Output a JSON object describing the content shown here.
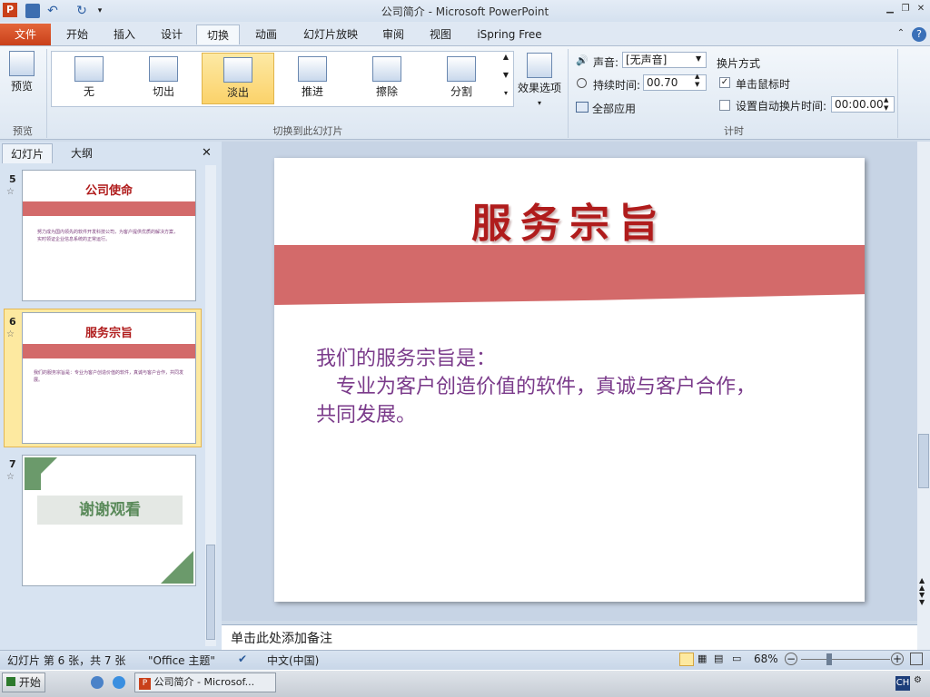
{
  "app": {
    "title": "公司简介 - Microsoft PowerPoint",
    "app_icon": "P"
  },
  "tabs": {
    "file": "文件",
    "items": [
      "开始",
      "插入",
      "设计",
      "切换",
      "动画",
      "幻灯片放映",
      "审阅",
      "视图",
      "iSpring Free"
    ]
  },
  "ribbon": {
    "preview": {
      "label": "预览",
      "group": "预览"
    },
    "gallery": [
      "无",
      "切出",
      "淡出",
      "推进",
      "擦除",
      "分割"
    ],
    "gallery_selected": "淡出",
    "effect_options": "效果选项",
    "group_transition": "切换到此幻灯片",
    "sound_label": "声音:",
    "sound_value": "[无声音]",
    "duration_label": "持续时间:",
    "duration_value": "00.70",
    "apply_all": "全部应用",
    "advance_title": "换片方式",
    "on_click": "单击鼠标时",
    "after_label": "设置自动换片时间:",
    "after_value": "00:00.00",
    "group_timing": "计时"
  },
  "panel": {
    "tab_slides": "幻灯片",
    "tab_outline": "大纲",
    "close": "✕"
  },
  "thumbs": [
    {
      "num": "5",
      "title": "公司使命",
      "body": "努力成为国内领先的软件开发科技公司，为客户提供优质的解决方案，实时领证企业信息系统的正常运行。"
    },
    {
      "num": "6",
      "title": "服务宗旨",
      "body": "我们的服务宗旨是：专业为客户创造价值的软件，真诚与客户合作，共同发展。"
    },
    {
      "num": "7",
      "title": "谢谢观看"
    }
  ],
  "slide": {
    "title": "服务宗旨",
    "line1": "我们的服务宗旨是：",
    "line2": "　专业为客户创造价值的软件，真诚与客户合作，",
    "line3": "共同发展。"
  },
  "notes": "单击此处添加备注",
  "status": {
    "slide_info": "幻灯片 第 6 张，共 7 张",
    "theme": "\"Office 主题\"",
    "lang": "中文(中国)",
    "zoom": "68%"
  },
  "taskbar": {
    "start": "开始",
    "window": "公司简介 - Microsof...",
    "ime": "CH"
  }
}
